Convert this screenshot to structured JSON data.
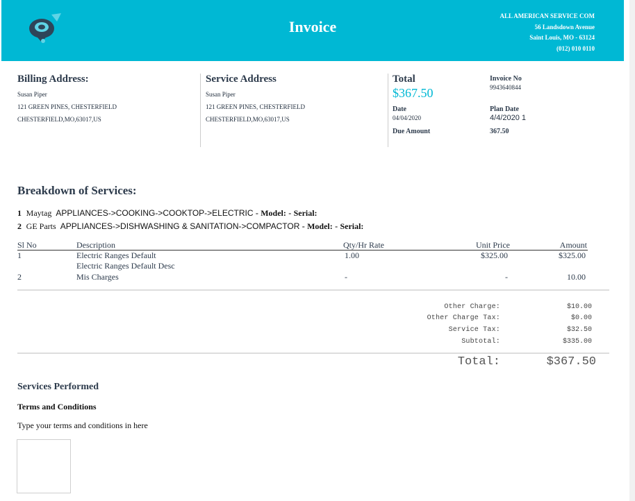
{
  "header": {
    "title": "Invoice",
    "company_name": "ALL AMERICAN SERVICE COM",
    "address_line1": "56 Landsdown Avenue",
    "address_line2": "Saint Louis, MO - 63124",
    "phone": "(012) 010 0110",
    "brand_color": "#00b8d4",
    "logo_icon": "map-pin-logo-icon"
  },
  "billing": {
    "heading": "Billing Address:",
    "name": "Susan Piper",
    "street": "121 GREEN PINES, CHESTERFIELD",
    "city": "CHESTERFIELD,MO,63017,US"
  },
  "service_address": {
    "heading": "Service Address",
    "name": "Susan Piper",
    "street": "121 GREEN PINES, CHESTERFIELD",
    "city": "CHESTERFIELD,MO,63017,US"
  },
  "summary": {
    "total_label": "Total",
    "total_value": "$367.50",
    "invoice_no_label": "Invoice No",
    "invoice_no": "9943640844",
    "date_label": "Date",
    "date": "04/04/2020",
    "plan_date_label": "Plan Date",
    "plan_date": "4/4/2020 1",
    "due_label": "Due Amount",
    "due_value": "367.50"
  },
  "breakdown": {
    "heading": "Breakdown of Services:",
    "services": [
      {
        "num": "1",
        "brand": "Maytag",
        "category": "APPLIANCES->COOKING->COOKTOP->ELECTRIC",
        "sep": "-",
        "model_label": "Model:",
        "sep2": "-",
        "serial_label": "Serial:"
      },
      {
        "num": "2",
        "brand": "GE Parts",
        "category": "APPLIANCES->DISHWASHING & SANITATION->COMPACTOR",
        "sep": "-",
        "model_label": "Model:",
        "sep2": "-",
        "serial_label": "Serial:"
      }
    ]
  },
  "table": {
    "headers": [
      "Sl No",
      "Description",
      "Qty/Hr Rate",
      "Unit Price",
      "Amount"
    ],
    "rows": [
      {
        "sl": "1",
        "desc": "Electric Ranges Default",
        "desc2": "Electric Ranges Default Desc",
        "qty": "1.00",
        "unit": "$325.00",
        "amount": "$325.00"
      },
      {
        "sl": "2",
        "desc": "Mis Charges",
        "desc2": "",
        "qty": "-",
        "unit": "-",
        "amount": "10.00"
      }
    ]
  },
  "totals": {
    "other_charge_label": "Other Charge:",
    "other_charge": "$10.00",
    "other_charge_tax_label": "Other Charge Tax:",
    "other_charge_tax": "$0.00",
    "service_tax_label": "Service Tax:",
    "service_tax": "$32.50",
    "subtotal_label": "Subtotal:",
    "subtotal": "$335.00",
    "total_label": "Total:",
    "total": "$367.50"
  },
  "footer": {
    "services_performed": "Services Performed",
    "terms_heading": "Terms and Conditions",
    "terms_text": "Type your terms and conditions in here"
  }
}
